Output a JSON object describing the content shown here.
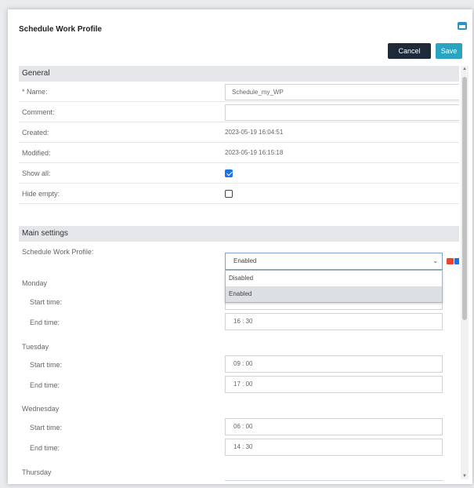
{
  "dialog": {
    "title": "Schedule Work Profile",
    "cancel_label": "Cancel",
    "save_label": "Save"
  },
  "general": {
    "header": "General",
    "name_label": "* Name:",
    "name_value": "Schedule_my_WP",
    "comment_label": "Comment:",
    "comment_value": "",
    "created_label": "Created:",
    "created_value": "2023-05-19 16:04:51",
    "modified_label": "Modified:",
    "modified_value": "2023-05-19 16:15:18",
    "show_all_label": "Show all:",
    "show_all_checked": true,
    "hide_empty_label": "Hide empty:",
    "hide_empty_checked": false
  },
  "main_settings": {
    "header": "Main settings",
    "profile_label": "Schedule Work Profile:",
    "profile_value": "Enabled",
    "options": [
      "Disabled",
      "Enabled"
    ],
    "selected_option": "Enabled",
    "start_label": "Start time:",
    "end_label": "End time:",
    "days": [
      {
        "name": "Monday",
        "start": "",
        "end": "16 : 30"
      },
      {
        "name": "Tuesday",
        "start": "09 : 00",
        "end": "17 : 00"
      },
      {
        "name": "Wednesday",
        "start": "06 : 00",
        "end": "14 : 30"
      },
      {
        "name": "Thursday",
        "start": "",
        "end": ""
      }
    ]
  },
  "colors": {
    "accent": "#2aa4c0",
    "cancel_bg": "#1e2a3a",
    "checkbox": "#1a73e8",
    "section_bg": "#e4e6ea"
  },
  "icons": {
    "window": "maximize-window-icon",
    "dropdown": "chevron-down-icon",
    "extra_red": "delete-icon",
    "extra_blue": "edit-icon"
  }
}
